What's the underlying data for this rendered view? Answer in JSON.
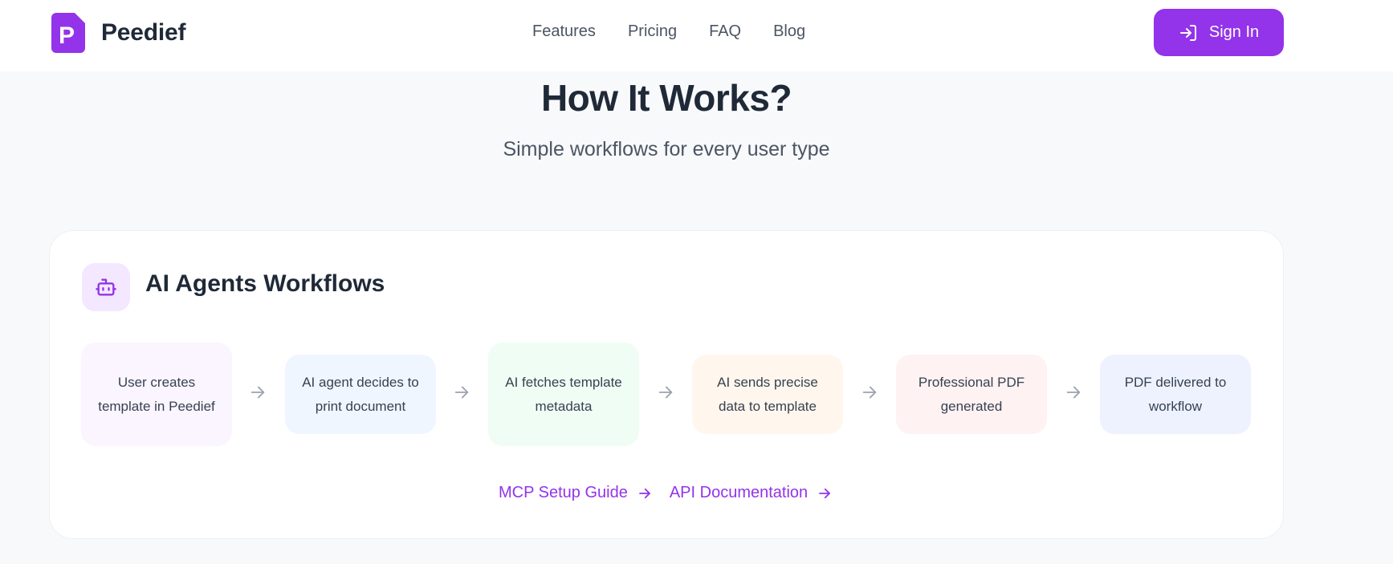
{
  "brand": {
    "name": "Peedief",
    "logo_letter": "P",
    "accent": "#9333ea"
  },
  "nav": {
    "items": [
      "Features",
      "Pricing",
      "FAQ",
      "Blog"
    ]
  },
  "signin": {
    "label": "Sign In"
  },
  "hero": {
    "title": "How It Works?",
    "subtitle": "Simple workflows for every user type"
  },
  "workflow": {
    "title": "AI Agents Workflows",
    "icon": "robot-icon",
    "steps": [
      {
        "label": "User creates template in Peedief",
        "bg": "#faf5ff"
      },
      {
        "label": "AI agent decides to print document",
        "bg": "#eff6ff"
      },
      {
        "label": "AI fetches template metadata",
        "bg": "#f0fdf4"
      },
      {
        "label": "AI sends precise data to template",
        "bg": "#fff7ed"
      },
      {
        "label": "Professional PDF generated",
        "bg": "#fef2f2"
      },
      {
        "label": "PDF delivered to workflow",
        "bg": "#eef2ff"
      }
    ],
    "links": [
      {
        "label": "MCP Setup Guide"
      },
      {
        "label": "API Documentation"
      }
    ]
  }
}
